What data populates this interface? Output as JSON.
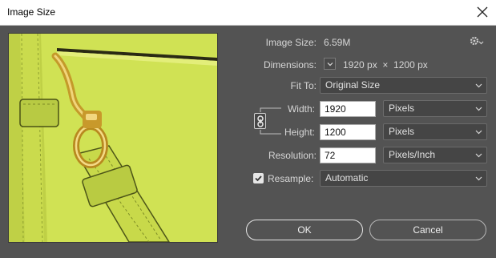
{
  "window": {
    "title": "Image Size"
  },
  "info": {
    "image_size_label": "Image Size:",
    "image_size_value": "6.59M",
    "dimensions_label": "Dimensions:",
    "dimensions_value": "1920 px  ×  1200 px"
  },
  "fit_to": {
    "label": "Fit To:",
    "value": "Original Size"
  },
  "width": {
    "label": "Width:",
    "value": "1920",
    "unit": "Pixels"
  },
  "height": {
    "label": "Height:",
    "value": "1200",
    "unit": "Pixels"
  },
  "resolution": {
    "label": "Resolution:",
    "value": "72",
    "unit": "Pixels/Inch"
  },
  "resample": {
    "label": "Resample:",
    "checked": true,
    "value": "Automatic"
  },
  "buttons": {
    "ok": "OK",
    "cancel": "Cancel"
  },
  "icons": {
    "close": "close-icon",
    "settings": "gear-icon",
    "link": "chain-link-icon",
    "dimensions_menu": "chevron-down-icon"
  },
  "colors": {
    "dialog_bg": "#535353",
    "titlebar_bg": "#ffffff",
    "preview_green": "#d4e655"
  }
}
